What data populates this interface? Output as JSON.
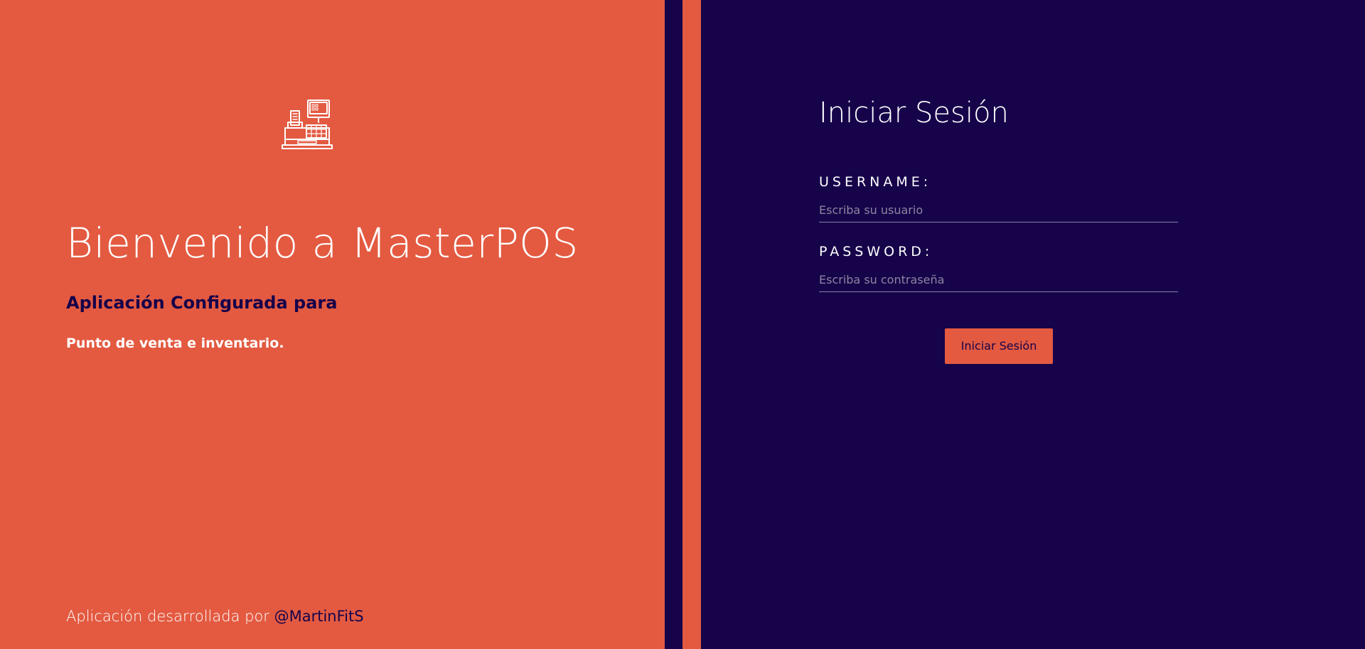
{
  "colors": {
    "accent": "#e35a41",
    "dark": "#16034a",
    "text_light": "#ffffff"
  },
  "welcome": {
    "logo_icon": "cash-register-icon",
    "title": "Bienvenido a MasterPOS",
    "subtitle": "Aplicación Configurada para",
    "description": "Punto de venta e inventario."
  },
  "footer": {
    "credit_prefix": "Aplicación desarrollada por ",
    "author": "@MartinFitS"
  },
  "login": {
    "title": "Iniciar Sesión",
    "username_label": "USERNAME:",
    "username_placeholder": "Escriba su usuario",
    "username_value": "",
    "password_label": "PASSWORD:",
    "password_placeholder": "Escriba su contraseña",
    "password_value": "",
    "submit_label": "Iniciar Sesión"
  }
}
